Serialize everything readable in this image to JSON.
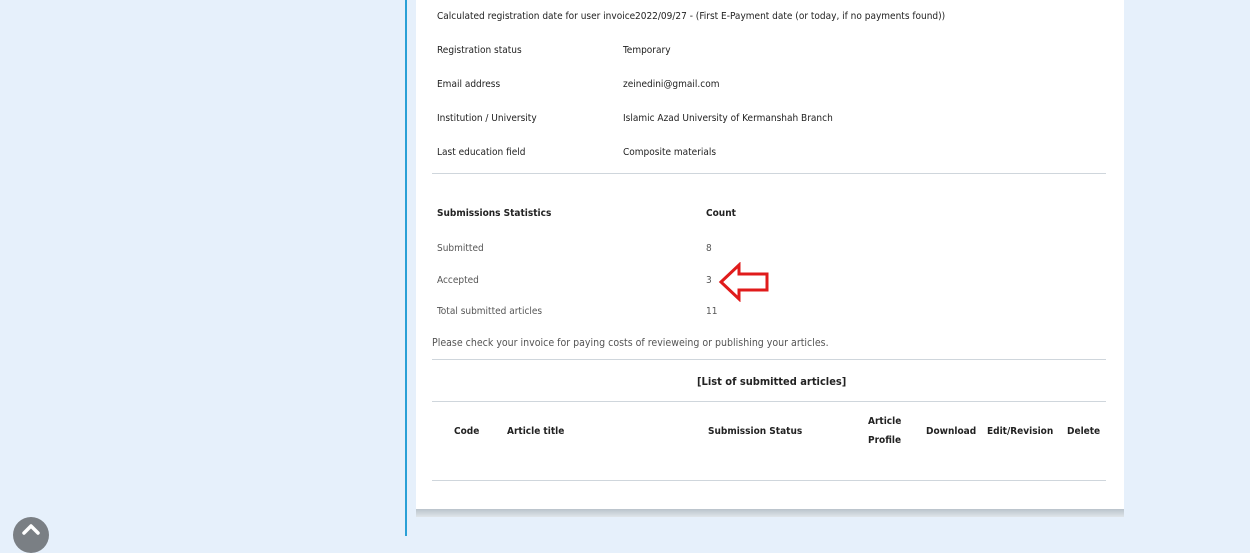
{
  "profile": {
    "rows": [
      {
        "label": "Calculated registration date for user invoice",
        "value": "2022/09/27 - (First E-Payment date (or today, if no payments found))"
      },
      {
        "label": "Registration status",
        "value": "Temporary"
      },
      {
        "label": "Email address",
        "value": "zeinedini@gmail.com"
      },
      {
        "label": "Institution / University",
        "value": "Islamic Azad University of Kermanshah Branch"
      },
      {
        "label": "Last education field",
        "value": "Composite materials"
      }
    ]
  },
  "stats": {
    "header_label": "Submissions Statistics",
    "header_count": "Count",
    "rows": [
      {
        "label": "Submitted",
        "count": "8"
      },
      {
        "label": "Accepted",
        "count": "3"
      },
      {
        "label": "Total submitted articles",
        "count": "11"
      }
    ]
  },
  "notice": "Please check your invoice for paying costs of revieweing or publishing your articles.",
  "articles": {
    "title": "[List of submitted articles]",
    "columns": {
      "code": "Code",
      "title": "Article title",
      "status": "Submission Status",
      "profile_line1": "Article",
      "profile_line2": "Profile",
      "download": "Download",
      "edit": "Edit/Revision",
      "delete": "Delete"
    }
  },
  "colors": {
    "page_bg": "#e6f0fb",
    "divider": "#2aa0d6",
    "annotation_arrow": "#e01b1b"
  },
  "icons": {
    "scroll_top": "chevron-up-icon",
    "annotation": "left-arrow-outline-icon"
  }
}
